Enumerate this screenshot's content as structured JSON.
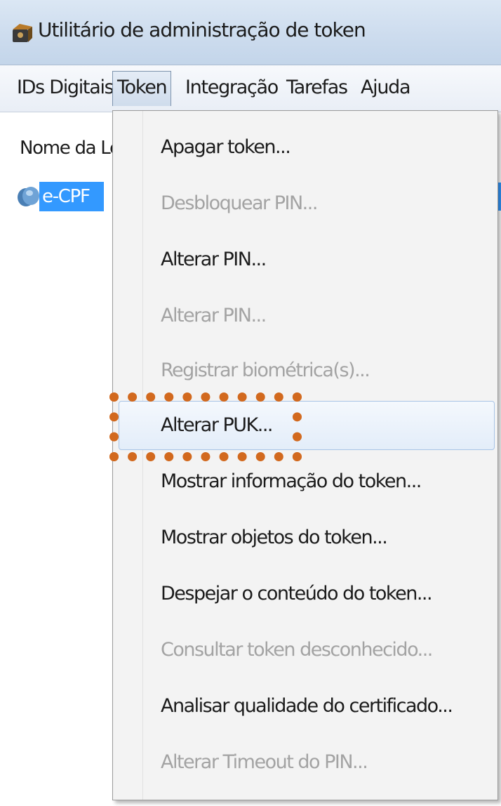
{
  "window": {
    "title": "Utilitário de administração de token",
    "icon": "token-utility-icon"
  },
  "menubar": {
    "items": [
      {
        "label": "IDs Digitais"
      },
      {
        "label": "Token"
      },
      {
        "label": "Integração"
      },
      {
        "label": "Tarefas"
      },
      {
        "label": "Ajuda"
      }
    ],
    "open_item": "Token"
  },
  "content": {
    "column_header": "Nome da Le",
    "tree_item": {
      "label": "e-CPF",
      "icon": "token-device-icon",
      "selected": true
    }
  },
  "dropdown": {
    "items": [
      {
        "label": "Apagar token...",
        "enabled": true
      },
      {
        "label": "Desbloquear PIN...",
        "enabled": false
      },
      {
        "label": "Alterar PIN...",
        "enabled": true
      },
      {
        "label": "Alterar PIN...",
        "enabled": false
      },
      {
        "label": "Registrar biométrica(s)...",
        "enabled": false
      },
      {
        "label": "Alterar PUK...",
        "enabled": true,
        "highlighted": true
      },
      {
        "label": "Mostrar informação do token...",
        "enabled": true
      },
      {
        "label": "Mostrar objetos do token...",
        "enabled": true
      },
      {
        "label": "Despejar o conteúdo do token...",
        "enabled": true
      },
      {
        "label": "Consultar token desconhecido...",
        "enabled": false
      },
      {
        "label": "Analisar qualidade do certificado...",
        "enabled": true
      },
      {
        "label": "Alterar Timeout do PIN...",
        "enabled": false
      }
    ]
  },
  "colors": {
    "annotation": "#d2691e",
    "selection": "#3399ff",
    "disabled_text": "#a3a3a3"
  }
}
